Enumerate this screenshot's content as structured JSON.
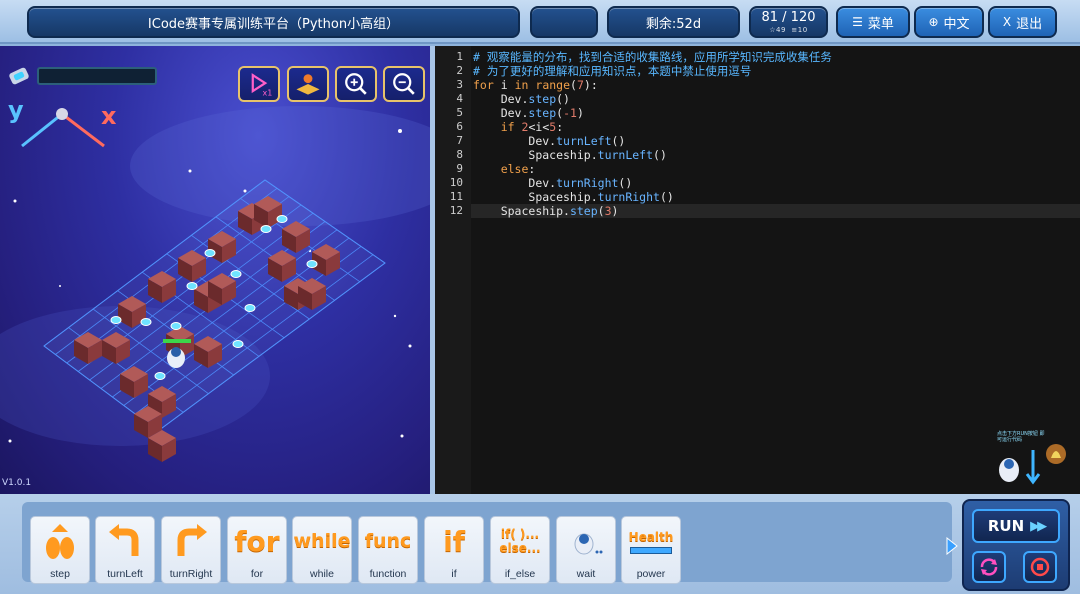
{
  "header": {
    "title": "ICode赛事专属训练平台（Python小高组）",
    "blank_label": "",
    "remaining": "剩余:52d",
    "progress": "81 / 120",
    "progress_sub_a": "49",
    "progress_sub_b": "10",
    "menu_label": "菜单",
    "lang_label": "中文",
    "exit_label": "退出",
    "menu_icon": "menu-icon",
    "lang_icon": "globe-icon",
    "exit_icon": "close-icon"
  },
  "scene": {
    "axis_y": "y",
    "axis_x": "x",
    "version": "V1.0.1",
    "tools": [
      "play-x1-icon",
      "map-pin-icon",
      "zoom-in-icon",
      "zoom-out-icon"
    ]
  },
  "editor": {
    "line_numbers": [
      "1",
      "2",
      "3",
      "4",
      "5",
      "6",
      "7",
      "8",
      "9",
      "10",
      "11",
      "12"
    ],
    "lines": [
      "# 观察能量的分布，找到合适的收集路线，应用所学知识完成收集任务",
      "# 为了更好的理解和应用知识点，本题中禁止使用逗号",
      "for i in range(7):",
      "    Dev.step()",
      "    Dev.step(-1)",
      "    if 2<i<5:",
      "        Dev.turnLeft()",
      "        Spaceship.turnLeft()",
      "    else:",
      "        Dev.turnRight()",
      "        Spaceship.turnRight()",
      "    Spaceship.step(3)"
    ],
    "helper_text": "点击下方RUN按钮 即可运行代码"
  },
  "blocks": [
    {
      "label": "step",
      "art": ""
    },
    {
      "label": "turnLeft",
      "art": ""
    },
    {
      "label": "turnRight",
      "art": ""
    },
    {
      "label": "for",
      "art": "for"
    },
    {
      "label": "while",
      "art": "while"
    },
    {
      "label": "function",
      "art": "func"
    },
    {
      "label": "if",
      "art": "if"
    },
    {
      "label": "if_else",
      "art": "if( )...\nelse..."
    },
    {
      "label": "wait",
      "art": ""
    },
    {
      "label": "power",
      "art": "Health"
    }
  ],
  "run": {
    "run_label": "RUN",
    "reset_icon": "refresh-icon",
    "stop_icon": "stop-icon"
  },
  "colors": {
    "accent": "#1f63b5",
    "keyword": "#f0a04b",
    "comment": "#58b7ff",
    "number": "#e07b6a"
  }
}
